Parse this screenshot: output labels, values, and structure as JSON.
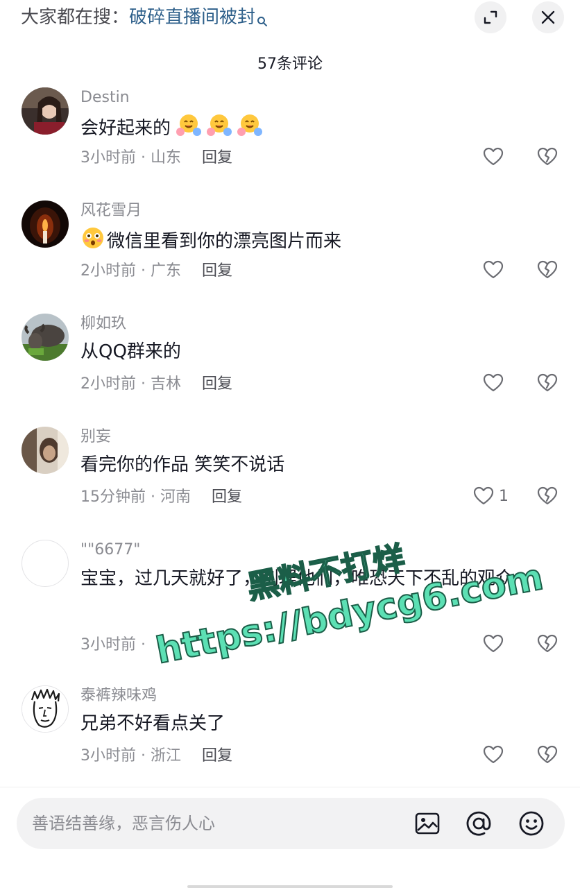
{
  "header": {
    "search_prefix": "大家都在搜：",
    "search_term": "破碎直播间被封",
    "search_icon": "search-icon",
    "expand_icon": "expand-icon",
    "close_icon": "close-icon"
  },
  "comments_title": "57条评论",
  "comments": [
    {
      "username": "Destin",
      "content": "会好起来的",
      "trailing_emoji": "hugging-face-emoji",
      "emoji_count": 3,
      "time": "3小时前",
      "location": "山东",
      "reply_label": "回复",
      "likes": ""
    },
    {
      "username": "风花雪月",
      "content": "微信里看到你的漂亮图片而来",
      "leading_emoji": "flushed-face-emoji",
      "time": "2小时前",
      "location": "广东",
      "reply_label": "回复",
      "likes": ""
    },
    {
      "username": "柳如玖",
      "content": "从QQ群来的",
      "time": "2小时前",
      "location": "吉林",
      "reply_label": "回复",
      "likes": ""
    },
    {
      "username": "别妄",
      "content": "看完你的作品 笑笑不说话",
      "time": "15分钟前",
      "location": "河南",
      "reply_label": "回复",
      "likes": "1"
    },
    {
      "username": "\"\"6677\"",
      "content": "宝宝，过几天就好了，别理他们，唯恐天下不乱的观众",
      "time": "3小时前",
      "location": "",
      "reply_label": "",
      "likes": ""
    },
    {
      "username": "泰裤辣味鸡",
      "content": "兄弟不好看点关了",
      "time": "3小时前",
      "location": "浙江",
      "reply_label": "回复",
      "likes": ""
    }
  ],
  "meta_separator": " · ",
  "watermark": {
    "line1": "黑料不打烊",
    "line2": "https://bdycg6.com",
    "color": "#5ce0b4"
  },
  "input_bar": {
    "placeholder": "善语结善缘，恶言伤人心",
    "image_icon": "image-icon",
    "mention_icon": "at-icon",
    "emoji_icon": "smiley-icon"
  }
}
